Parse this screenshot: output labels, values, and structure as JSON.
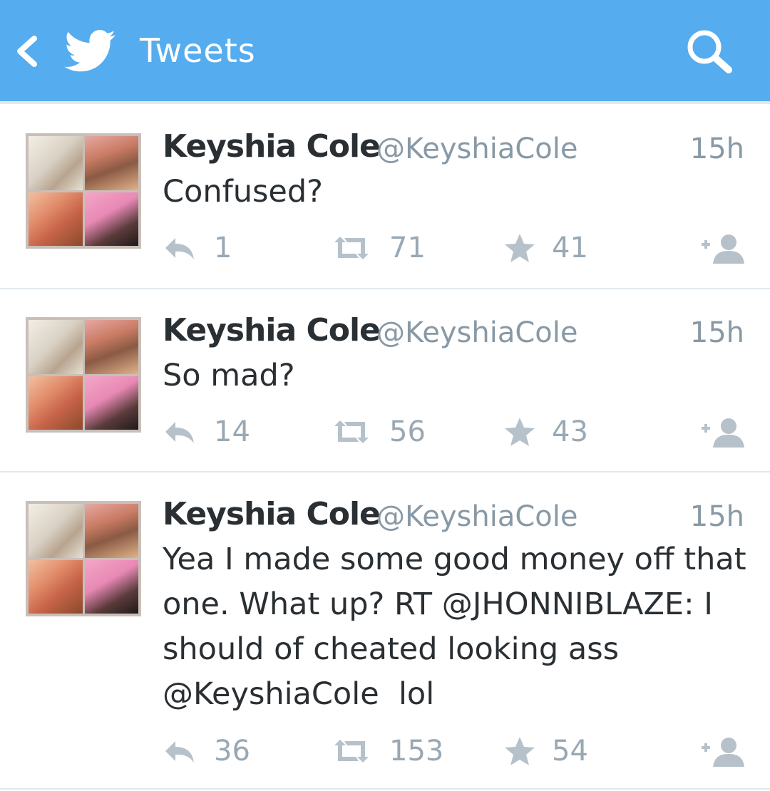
{
  "header": {
    "title": "Tweets",
    "back_icon": "chevron-left-icon",
    "logo_icon": "twitter-bird-icon",
    "search_icon": "search-icon",
    "background_color": "#55acee"
  },
  "tweets": [
    {
      "name": "Keyshia Cole",
      "handle": "@KeyshiaCole",
      "time": "15h",
      "text": "Confused?",
      "replies": "1",
      "retweets": "71",
      "favorites": "41"
    },
    {
      "name": "Keyshia Cole",
      "handle": "@KeyshiaCole",
      "time": "15h",
      "text": "So mad?",
      "replies": "14",
      "retweets": "56",
      "favorites": "43"
    },
    {
      "name": "Keyshia Cole",
      "handle": "@KeyshiaCole",
      "time": "15h",
      "text_lines": [
        "Yea I made some good money off that",
        "one. What up? RT @JHONNIBLAZE: I",
        "should of cheated looking ass",
        "@KeyshiaCole  lol"
      ],
      "replies": "36",
      "retweets": "153",
      "favorites": "54"
    }
  ],
  "icons": {
    "reply": "reply-icon",
    "retweet": "retweet-icon",
    "favorite": "star-icon",
    "follow": "follow-user-icon"
  }
}
